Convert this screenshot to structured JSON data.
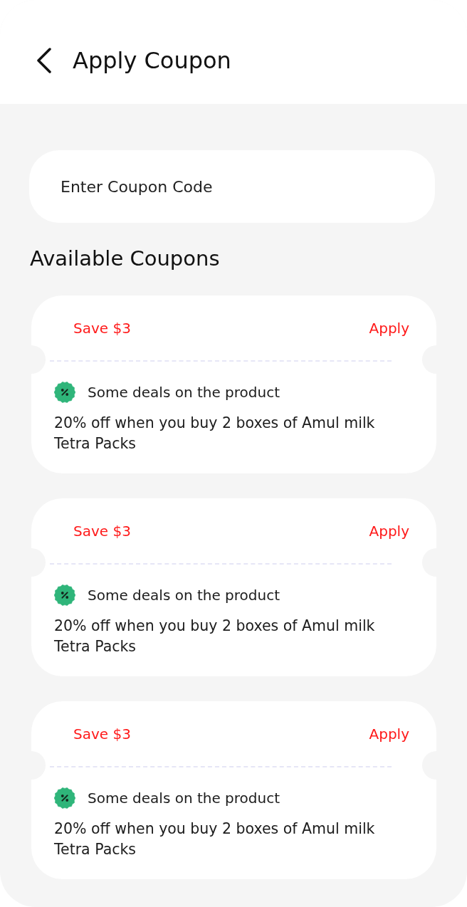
{
  "header": {
    "title": "Apply Coupon"
  },
  "coupon_field": {
    "placeholder": "Enter Coupon Code"
  },
  "available_coupons": {
    "heading": "Available Coupons",
    "coupons": [
      {
        "savings": "Save $3",
        "action": "Apply",
        "deal_title": "Some deals on the product",
        "description": "20% off when you buy 2 boxes of Amul milk Tetra Packs"
      },
      {
        "savings": "Save $3",
        "action": "Apply",
        "deal_title": "Some deals on the product",
        "description": "20% off when you buy 2 boxes of Amul milk Tetra Packs"
      },
      {
        "savings": "Save $3",
        "action": "Apply",
        "deal_title": "Some deals on the product",
        "description": "20% off when you buy 2 boxes of Amul milk Tetra Packs"
      }
    ]
  }
}
